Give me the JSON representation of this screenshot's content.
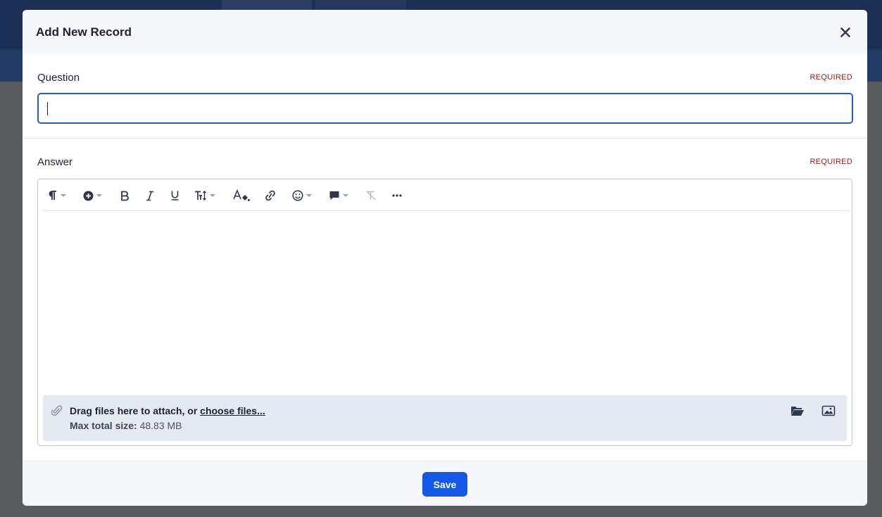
{
  "modal": {
    "title": "Add New Record",
    "close_icon": "close-icon"
  },
  "question": {
    "label": "Question",
    "required": "REQUIRED",
    "value": "",
    "placeholder": ""
  },
  "answer": {
    "label": "Answer",
    "required": "REQUIRED",
    "toolbar": [
      {
        "name": "paragraph-format-icon",
        "dropdown": true
      },
      {
        "name": "insert-icon",
        "dropdown": true
      },
      {
        "name": "bold-icon",
        "dropdown": false
      },
      {
        "name": "italic-icon",
        "dropdown": false
      },
      {
        "name": "underline-icon",
        "dropdown": false
      },
      {
        "name": "font-size-icon",
        "dropdown": true
      },
      {
        "name": "text-color-icon",
        "dropdown": false
      },
      {
        "name": "link-icon",
        "dropdown": false
      },
      {
        "name": "emoji-icon",
        "dropdown": true
      },
      {
        "name": "comment-icon",
        "dropdown": true
      },
      {
        "name": "clear-formatting-icon",
        "dropdown": false,
        "disabled": true
      },
      {
        "name": "more-icon",
        "dropdown": false
      }
    ],
    "dropzone": {
      "text": "Drag files here to attach, or ",
      "link": "choose files...",
      "max_label": "Max total size:",
      "max_value": "48.83 MB"
    }
  },
  "footer": {
    "save_label": "Save"
  },
  "colors": {
    "accent": "#1458e8",
    "required": "#9b1a1a",
    "focus_border": "#2560c9"
  }
}
